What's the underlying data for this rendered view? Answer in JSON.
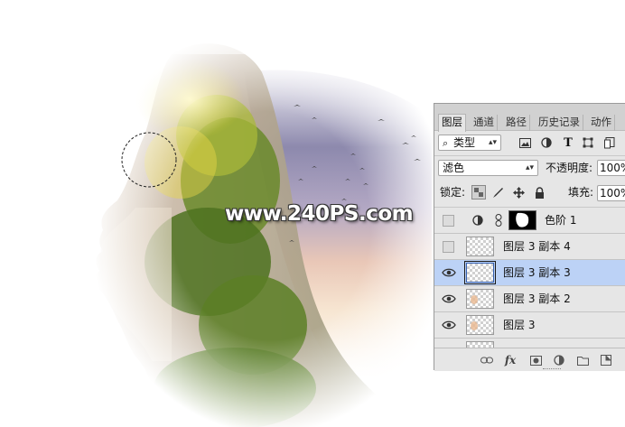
{
  "watermark": "www.240PS.com",
  "panel": {
    "tabs": [
      "图层",
      "通道",
      "路径",
      "历史记录",
      "动作"
    ],
    "filter": {
      "label": "类型",
      "icon": "search-icon"
    },
    "blend_mode": "滤色",
    "opacity_label": "不透明度:",
    "opacity_value": "100%",
    "lock_label": "锁定:",
    "fill_label": "填充:",
    "fill_value": "100%",
    "layers": [
      {
        "name": "色阶 1",
        "visible": false,
        "type": "adjustment"
      },
      {
        "name": "图层 3 副本 4",
        "visible": false,
        "type": "pixel"
      },
      {
        "name": "图层 3 副本 3",
        "visible": true,
        "type": "pixel",
        "selected": true
      },
      {
        "name": "图层 3 副本 2",
        "visible": true,
        "type": "pixel"
      },
      {
        "name": "图层 3",
        "visible": true,
        "type": "pixel"
      }
    ],
    "bottom_icons": [
      "link-icon",
      "fx-icon",
      "mask-icon",
      "adjustment-icon",
      "folder-icon",
      "new-layer-icon"
    ],
    "fx_label": "fx",
    "colors": {
      "selected_row": "#bcd2f6",
      "panel_bg": "#e6e6e6"
    }
  }
}
